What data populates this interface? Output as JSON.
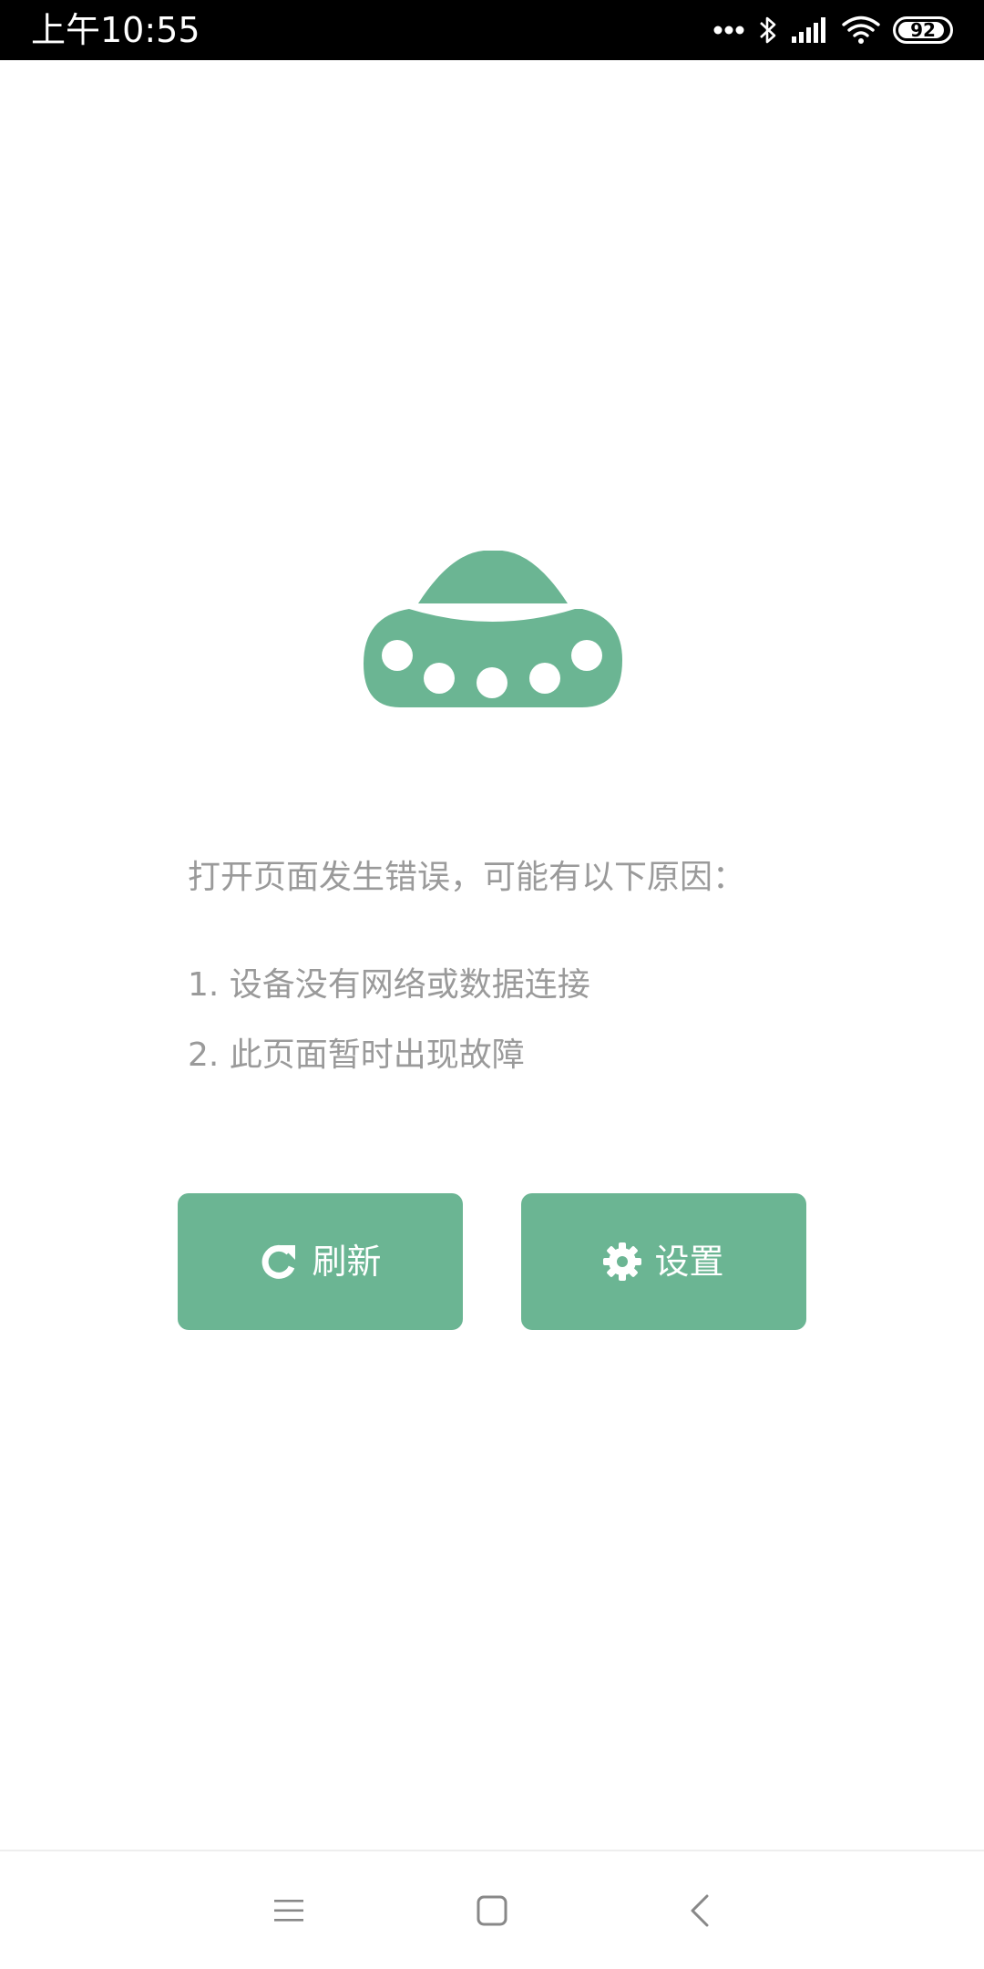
{
  "status_bar": {
    "time": "上午10:55",
    "battery_text": "92",
    "battery_level_percent": 92,
    "icons": [
      "more-dots-icon",
      "bluetooth-icon",
      "signal-icon",
      "wifi-icon",
      "battery-icon"
    ]
  },
  "illustration": {
    "icon": "ufo-icon",
    "color": "#6bb593"
  },
  "error": {
    "title": "打开页面发生错误，可能有以下原因：",
    "reasons": [
      "1. 设备没有网络或数据连接",
      "2. 此页面暂时出现故障"
    ]
  },
  "actions": {
    "refresh": {
      "label": "刷新",
      "icon": "refresh-icon"
    },
    "settings": {
      "label": "设置",
      "icon": "gear-icon"
    }
  },
  "nav_bar": {
    "icons": [
      "menu-icon",
      "home-square-icon",
      "back-chevron-icon"
    ]
  },
  "colors": {
    "accent": "#6bb593",
    "text_muted": "#9a9a9a",
    "status_bar_bg": "#000000"
  }
}
